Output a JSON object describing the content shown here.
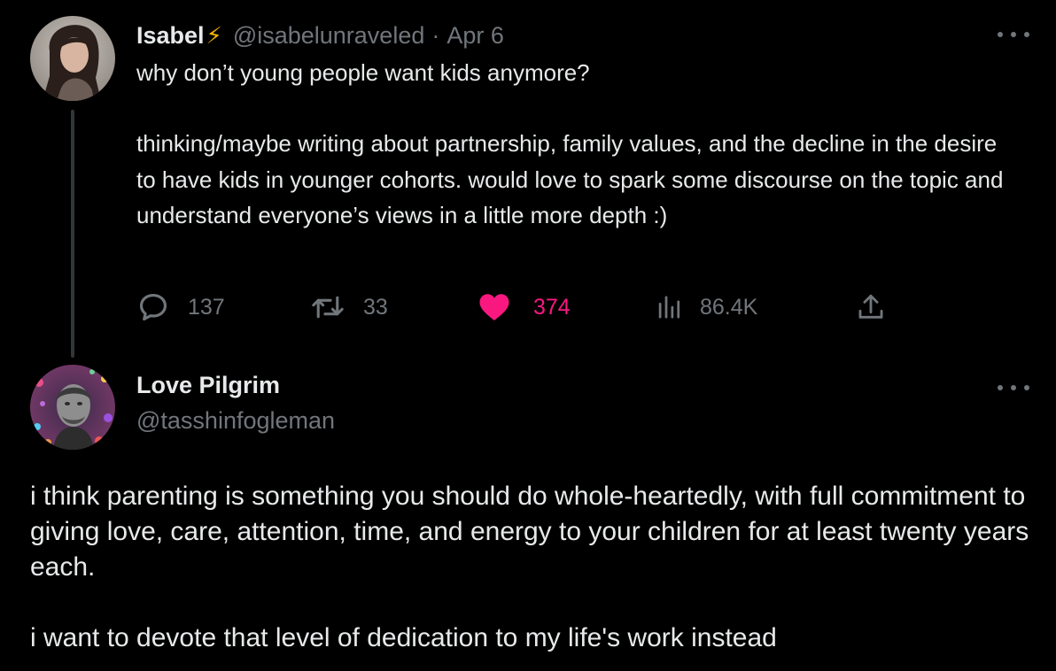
{
  "parent_tweet": {
    "name": "Isabel",
    "badge": "⚡",
    "handle": "@isabelunraveled",
    "separator": "·",
    "date": "Apr 6",
    "text_line1": "why don’t young people want kids anymore?",
    "text_body": "thinking/maybe writing about partnership, family values, and the decline in the desire to have kids in younger cohorts. would love to spark some discourse on the topic and understand everyone’s views in a little more depth :)",
    "actions": {
      "replies": "137",
      "retweets": "33",
      "likes": "374",
      "views": "86.4K"
    },
    "liked": true,
    "like_color": "#f91880"
  },
  "reply_tweet": {
    "name": "Love Pilgrim",
    "handle": "@tasshinfogleman",
    "paragraph1": "i think parenting is something you should do whole-heartedly, with full commitment to giving love, care, attention, time, and energy to your children for at least twenty years each.",
    "paragraph2": "i want to devote that level of dedication to my life's work instead"
  },
  "colors": {
    "background": "#000000",
    "text": "#e7e9ea",
    "muted": "#71767b",
    "like": "#f91880",
    "bolt": "#f5b400"
  }
}
